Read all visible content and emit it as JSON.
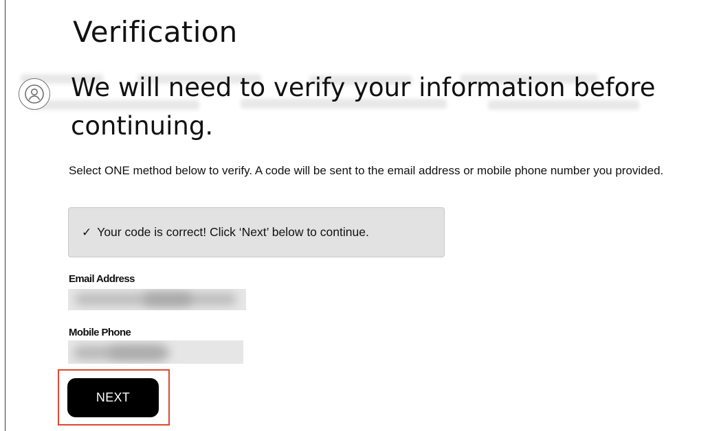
{
  "page": {
    "title": "Verification"
  },
  "verification": {
    "heading": "We will need to verify your information before continuing.",
    "instructions": "Select ONE method below to verify. A code will be sent to the email address or mobile phone number you provided.",
    "success_icon": "✓",
    "success_message": "Your code is correct! Click ‘Next’ below to continue."
  },
  "fields": {
    "email_label": "Email Address",
    "phone_label": "Mobile Phone"
  },
  "actions": {
    "next_label": "NEXT",
    "highlight_color": "#e0452d"
  },
  "icons": {
    "profile": "profile-circle-icon",
    "check": "checkmark-icon"
  }
}
